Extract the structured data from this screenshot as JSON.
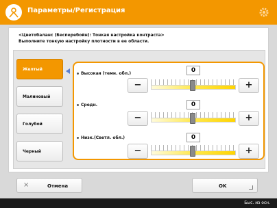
{
  "header": {
    "title": "Параметры/Регистрация",
    "icon": "settings-registration-icon"
  },
  "description": {
    "line1": "<Цветобаланс (Бесперебойн): Тонкая настройка контраста>",
    "line2": "Выполните тонкую настройку плотности в ее области."
  },
  "colors": [
    {
      "label": "Желтый",
      "selected": true
    },
    {
      "label": "Малиновый",
      "selected": false
    },
    {
      "label": "Голубой",
      "selected": false
    },
    {
      "label": "Черный",
      "selected": false
    }
  ],
  "adjustments": [
    {
      "label": "Высокая (темн. обл.)",
      "value": "0",
      "minus": "−",
      "plus": "+",
      "level": 0
    },
    {
      "label": "Средн.",
      "value": "0",
      "minus": "−",
      "plus": "+",
      "level": 0
    },
    {
      "label": "Низк.(Светл. обл.)",
      "value": "0",
      "minus": "−",
      "plus": "+",
      "level": 0
    }
  ],
  "footer": {
    "cancel_label": "Отмена",
    "cancel_icon": "×",
    "ok_label": "OK"
  },
  "statusbar": {
    "text": "Быс. из осн."
  },
  "theme": {
    "accent": "#f39700",
    "track_to": "#ffd400"
  }
}
